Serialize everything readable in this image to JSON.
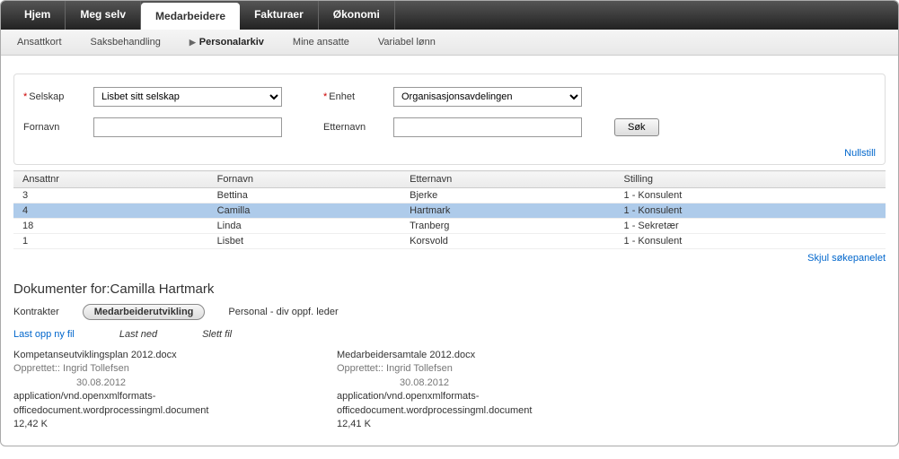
{
  "mainNav": {
    "tabs": [
      "Hjem",
      "Meg selv",
      "Medarbeidere",
      "Fakturaer",
      "Økonomi"
    ],
    "activeIndex": 2
  },
  "subNav": {
    "items": [
      "Ansattkort",
      "Saksbehandling",
      "Personalarkiv",
      "Mine ansatte",
      "Variabel lønn"
    ],
    "activeIndex": 2
  },
  "search": {
    "labels": {
      "selskap": "Selskap",
      "enhet": "Enhet",
      "fornavn": "Fornavn",
      "etternavn": "Etternavn"
    },
    "selskapValue": "Lisbet sitt selskap",
    "enhetValue": "Organisasjonsavdelingen",
    "fornavnValue": "",
    "etternavnValue": "",
    "searchBtn": "Søk",
    "resetLink": "Nullstill"
  },
  "results": {
    "headers": [
      "Ansattnr",
      "Fornavn",
      "Etternavn",
      "Stilling"
    ],
    "rows": [
      {
        "nr": "3",
        "fornavn": "Bettina",
        "etternavn": "Bjerke",
        "stilling": "1 - Konsulent",
        "selected": false
      },
      {
        "nr": "4",
        "fornavn": "Camilla",
        "etternavn": "Hartmark",
        "stilling": "1 - Konsulent",
        "selected": true
      },
      {
        "nr": "18",
        "fornavn": "Linda",
        "etternavn": "Tranberg",
        "stilling": "1 - Sekretær",
        "selected": false
      },
      {
        "nr": "1",
        "fornavn": "Lisbet",
        "etternavn": "Korsvold",
        "stilling": "1 - Konsulent",
        "selected": false
      }
    ],
    "hidePanelLink": "Skjul søkepanelet"
  },
  "documents": {
    "titlePrefix": "Dokumenter for:",
    "titleName": "Camilla Hartmark",
    "tabs": [
      "Kontrakter",
      "Medarbeiderutvikling",
      "Personal - div oppf. leder"
    ],
    "activeTabIndex": 1,
    "actions": {
      "upload": "Last opp ny fil",
      "download": "Last ned",
      "delete": "Slett fil"
    },
    "items": [
      {
        "name": "Kompetanseutviklingsplan 2012.docx",
        "createdLabel": "Opprettet::",
        "createdBy": "Ingrid Tollefsen",
        "createdDate": "30.08.2012",
        "mime": "application/vnd.openxmlformats-officedocument.wordprocessingml.document",
        "size": "12,42 K"
      },
      {
        "name": "Medarbeidersamtale 2012.docx",
        "createdLabel": "Opprettet::",
        "createdBy": "Ingrid Tollefsen",
        "createdDate": "30.08.2012",
        "mime": "application/vnd.openxmlformats-officedocument.wordprocessingml.document",
        "size": "12,41 K"
      }
    ]
  }
}
